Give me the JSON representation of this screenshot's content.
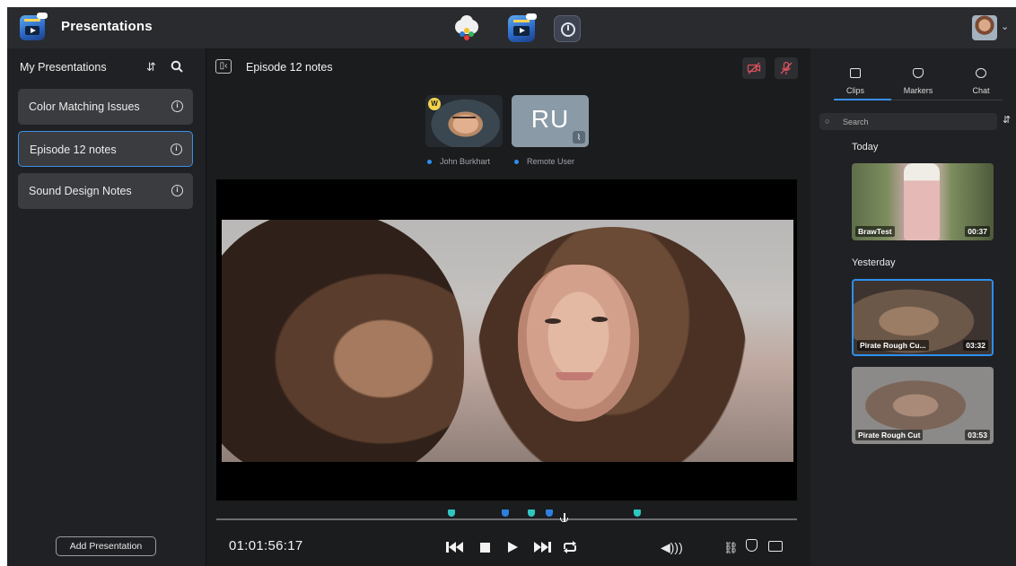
{
  "app": {
    "title": "Presentations",
    "top_icons": [
      "cloud-icon",
      "presentations-app-icon",
      "settings-clock-icon"
    ],
    "user_menu_chevron": "⌄"
  },
  "left_panel": {
    "title": "My Presentations",
    "sort_icon": "sort-icon",
    "search_icon": "search-icon",
    "items": [
      {
        "label": "Color Matching Issues",
        "selected": false
      },
      {
        "label": "Episode 12 notes",
        "selected": true
      },
      {
        "label": "Sound Design Notes",
        "selected": false
      }
    ],
    "add_button": "Add Presentation"
  },
  "center": {
    "title": "Episode 12 notes",
    "collapse_icon": "sidebar-collapse-icon",
    "participants": [
      {
        "name": "John Burkhart",
        "avatar": "photo",
        "badge": "W"
      },
      {
        "name": "Remote User",
        "initials": "RU",
        "muted": true
      }
    ],
    "timecode": "01:01:56:17",
    "playhead_fraction": 0.6,
    "markers": [
      {
        "fraction": 0.405,
        "color": "#2ec7c0"
      },
      {
        "fraction": 0.497,
        "color": "#2d7fe0"
      },
      {
        "fraction": 0.543,
        "color": "#2ec7c0"
      },
      {
        "fraction": 0.573,
        "color": "#2d7fe0"
      },
      {
        "fraction": 0.725,
        "color": "#2ec7c0"
      }
    ],
    "transport": [
      "skip-back-icon",
      "stop-icon",
      "play-icon",
      "skip-forward-icon",
      "loop-icon"
    ],
    "right_controls": [
      "volume-icon",
      "link-icon",
      "marker-icon",
      "fullscreen-icon"
    ]
  },
  "right_panel": {
    "tabs": [
      {
        "label": "Clips",
        "active": true
      },
      {
        "label": "Markers",
        "active": false
      },
      {
        "label": "Chat",
        "active": false
      }
    ],
    "search_placeholder": "Search",
    "groups": [
      {
        "label": "Today",
        "clips": [
          {
            "name": "BrawTest",
            "duration": "00:37",
            "selected": false
          }
        ]
      },
      {
        "label": "Yesterday",
        "clips": [
          {
            "name": "Pirate Rough Cu...",
            "duration": "03:32",
            "selected": true
          },
          {
            "name": "Pirate Rough Cut",
            "duration": "03:53",
            "selected": false
          }
        ]
      }
    ]
  },
  "colors": {
    "accent": "#3b8ff0",
    "background": "#1b1c1e",
    "panel": "#202124",
    "topbar": "#2a2b2e"
  }
}
